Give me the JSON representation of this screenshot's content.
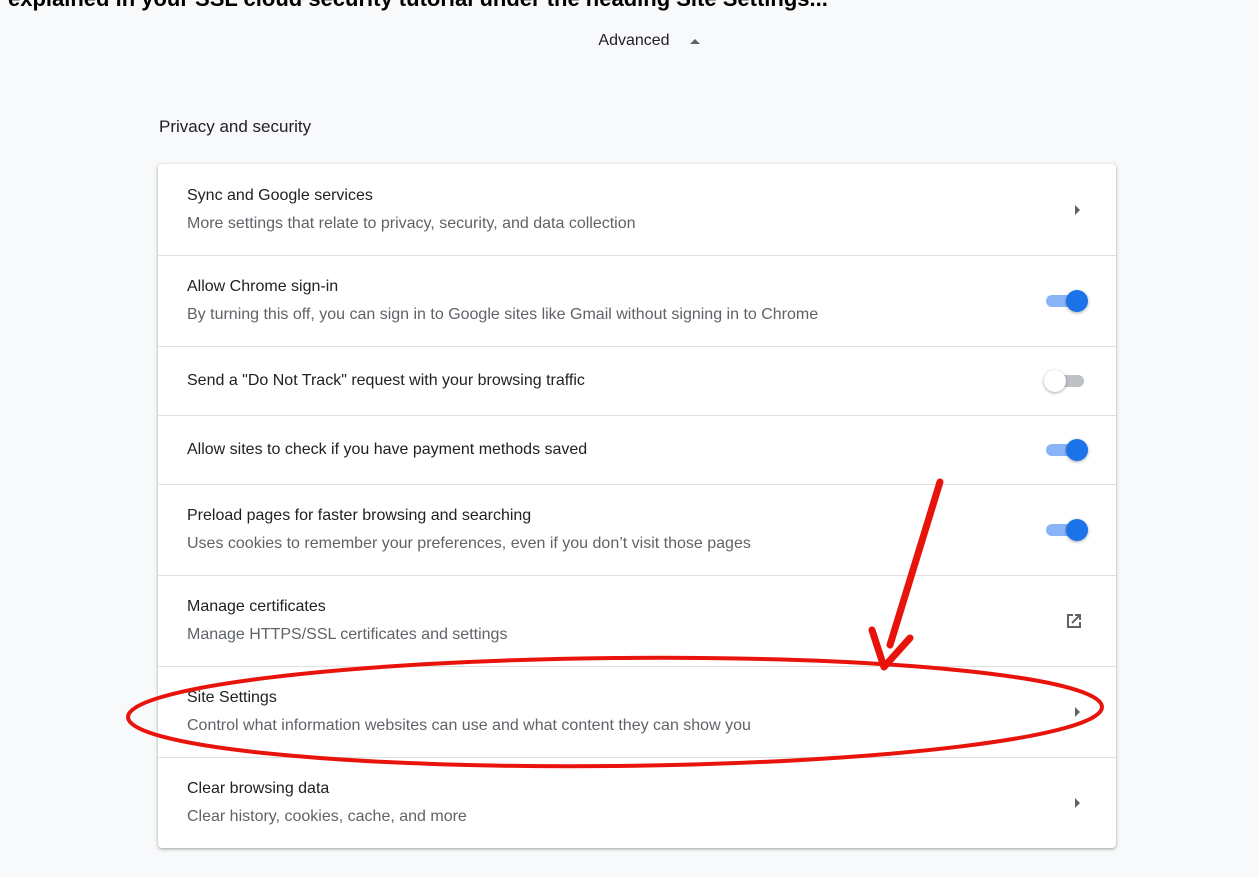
{
  "header": {
    "cut_text": "explained in your SSL cloud security tutorial under the heading Site Settings...",
    "advanced_label": "Advanced"
  },
  "section": {
    "title": "Privacy and security"
  },
  "rows": [
    {
      "title": "Sync and Google services",
      "subtitle": "More settings that relate to privacy, security, and data collection",
      "control": "chevron-right-icon"
    },
    {
      "title": "Allow Chrome sign-in",
      "subtitle": "By turning this off, you can sign in to Google sites like Gmail without signing in to Chrome",
      "control": "toggle",
      "checked": true
    },
    {
      "title": "Send a \"Do Not Track\" request with your browsing traffic",
      "control": "toggle",
      "checked": false
    },
    {
      "title": "Allow sites to check if you have payment methods saved",
      "control": "toggle",
      "checked": true
    },
    {
      "title": "Preload pages for faster browsing and searching",
      "subtitle": "Uses cookies to remember your preferences, even if you don’t visit those pages",
      "control": "toggle",
      "checked": true
    },
    {
      "title": "Manage certificates",
      "subtitle": "Manage HTTPS/SSL certificates and settings",
      "control": "open-in-new-icon"
    },
    {
      "title": "Site Settings",
      "subtitle": "Control what information websites can use and what content they can show you",
      "control": "chevron-right-icon"
    },
    {
      "title": "Clear browsing data",
      "subtitle": "Clear history, cookies, cache, and more",
      "control": "chevron-right-icon"
    }
  ],
  "annotation": {
    "color": "#e8140c",
    "shapes": [
      "red-arrow",
      "red-ellipse"
    ]
  },
  "colors": {
    "toggle_on": "#1a73e8",
    "toggle_on_track": "#8ab4f8",
    "toggle_off_track": "#bdc1c6",
    "page_bg": "#f8f9fa"
  }
}
